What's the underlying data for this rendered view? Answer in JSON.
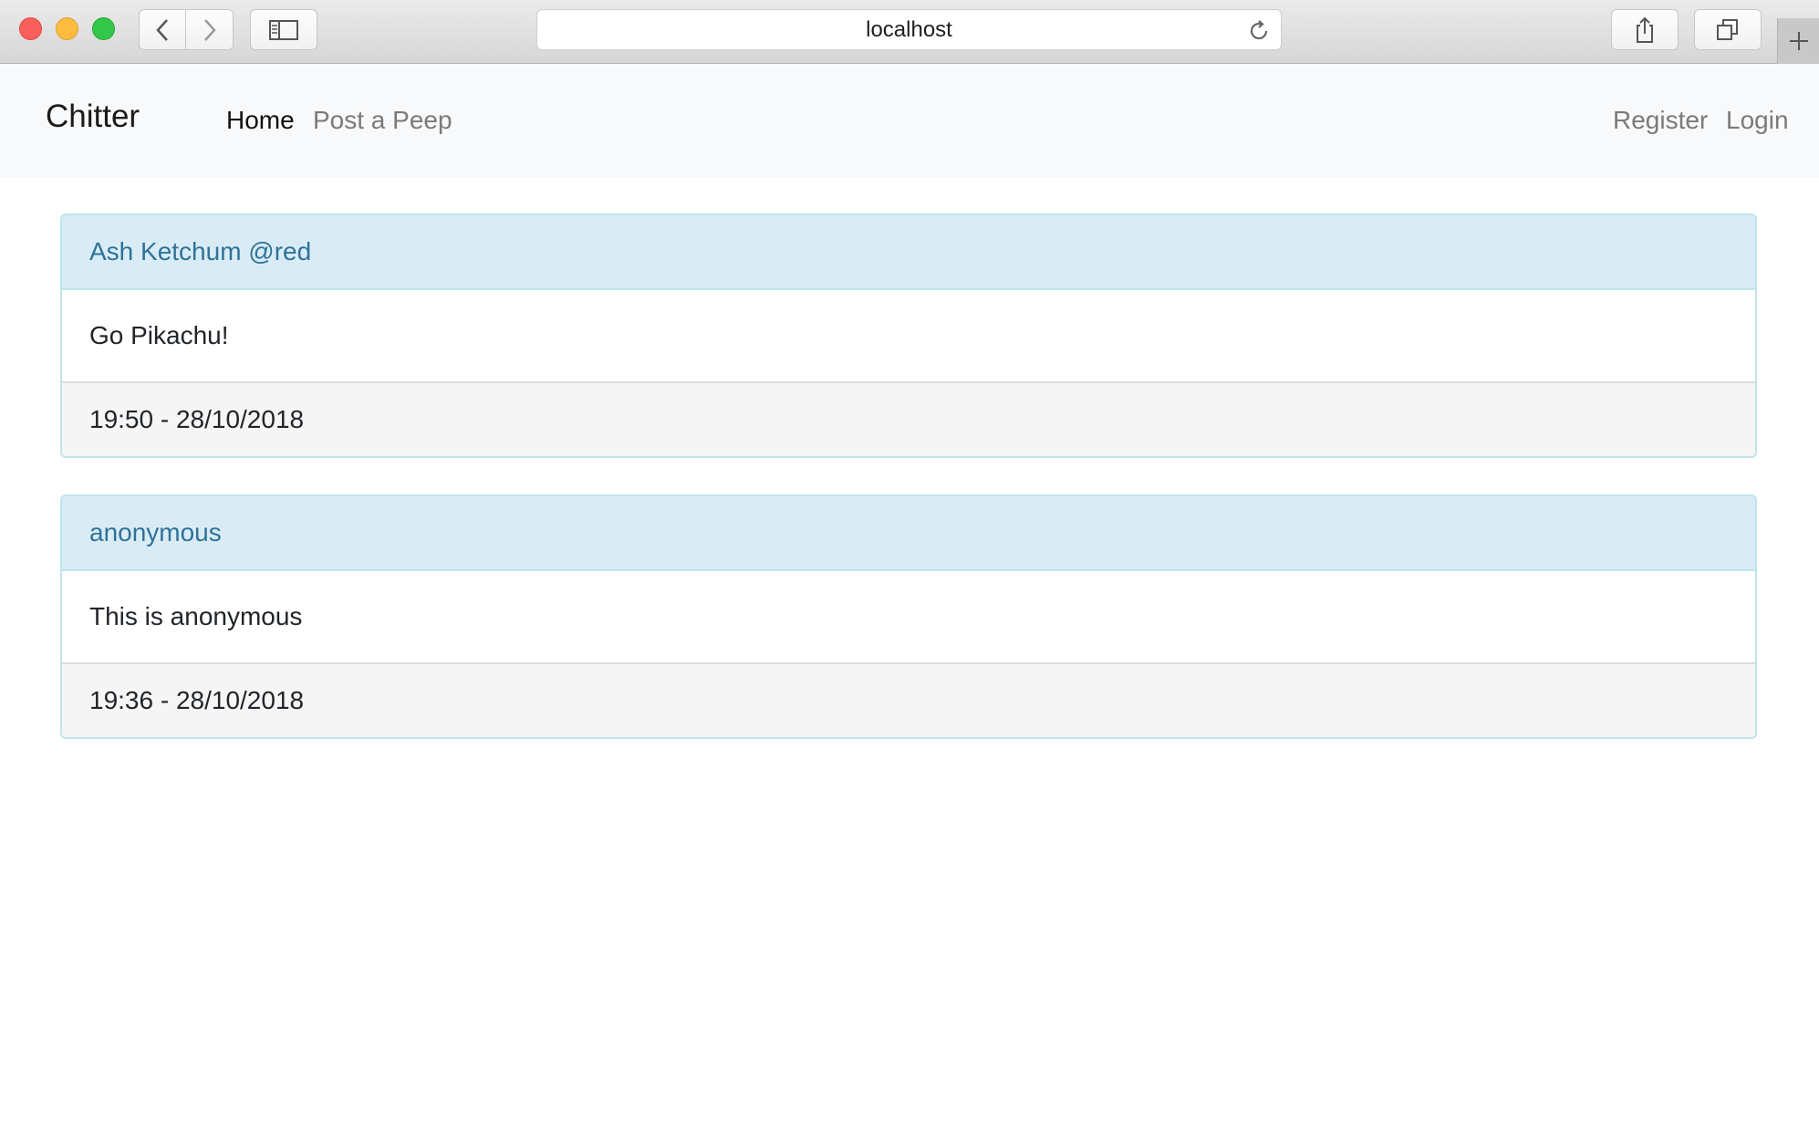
{
  "browser": {
    "address": "localhost",
    "icons": {
      "back": "chevron-left-icon",
      "forward": "chevron-right-icon",
      "sidebar": "sidebar-icon",
      "reload": "reload-icon",
      "share": "share-icon",
      "tabs": "tabs-overview-icon",
      "new_tab": "plus-icon"
    }
  },
  "navbar": {
    "brand": "Chitter",
    "links": [
      {
        "label": "Home",
        "active": true
      },
      {
        "label": "Post a Peep",
        "active": false
      }
    ],
    "right_links": [
      {
        "label": "Register"
      },
      {
        "label": "Login"
      }
    ]
  },
  "peeps": [
    {
      "author": "Ash Ketchum @red",
      "content": "Go Pikachu!",
      "timestamp": "19:50 - 28/10/2018"
    },
    {
      "author": "anonymous",
      "content": "This is anonymous",
      "timestamp": "19:36 - 28/10/2018"
    }
  ],
  "colors": {
    "card_header_bg": "#d9ecf5",
    "card_header_text": "#2f7299",
    "card_border": "#bee5eb",
    "card_footer_bg": "#f5f5f5",
    "navbar_bg": "#f8f9fa"
  }
}
